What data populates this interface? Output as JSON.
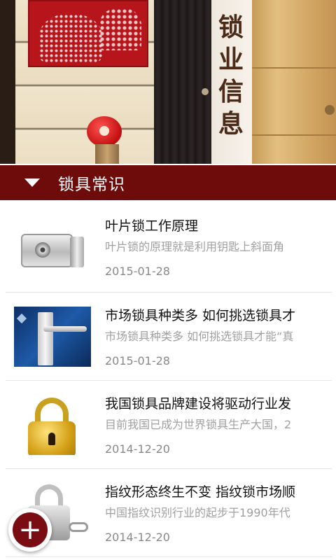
{
  "banner": {
    "calligraphy": "锁业信息"
  },
  "section": {
    "title": "锁具常识"
  },
  "articles": [
    {
      "title": "叶片锁工作原理",
      "summary": "叶片锁的原理就是利用钥匙上斜面角",
      "date": "2015-01-28",
      "thumb": "electric-rim-lock"
    },
    {
      "title": "市场锁具种类多 如何挑选锁具才",
      "summary": "市场锁具种类多 如何挑选锁具才能“真",
      "date": "2015-01-28",
      "thumb": "door-handle-lock"
    },
    {
      "title": "我国锁具品牌建设将驱动行业发",
      "summary": "目前我国已成为世界锁具生产大国，2",
      "date": "2014-12-20",
      "thumb": "gold-padlock"
    },
    {
      "title": "指纹形态终生不变 指纹锁市场顺",
      "summary": "中国指纹识别行业的起步于1990年代",
      "date": "2014-12-20",
      "thumb": "fingerprint-padlock"
    }
  ],
  "fab": {
    "symbol": "+"
  },
  "colors": {
    "header": "#6e0b0b",
    "fab": "#7a0d14"
  }
}
